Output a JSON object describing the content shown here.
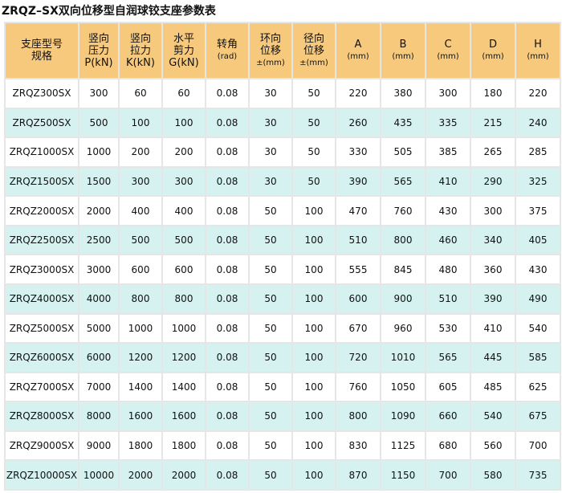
{
  "title": "ZRQZ–SX双向位移型自润球铰支座参数表",
  "headers": [
    {
      "l1": "支座型号",
      "l2": "规格",
      "l3": ""
    },
    {
      "l1": "竖向",
      "l2": "压力",
      "l3": "P(kN)"
    },
    {
      "l1": "竖向",
      "l2": "拉力",
      "l3": "K(kN)"
    },
    {
      "l1": "水平",
      "l2": "剪力",
      "l3": "G(kN)"
    },
    {
      "l1": "转角",
      "l2": "(rad)",
      "l3": ""
    },
    {
      "l1": "环向",
      "l2": "位移",
      "l3": "±(mm)"
    },
    {
      "l1": "径向",
      "l2": "位移",
      "l3": "±(mm)"
    },
    {
      "l1": "A",
      "l2": "(mm)",
      "l3": ""
    },
    {
      "l1": "B",
      "l2": "(mm)",
      "l3": ""
    },
    {
      "l1": "C",
      "l2": "(mm)",
      "l3": ""
    },
    {
      "l1": "D",
      "l2": "(mm)",
      "l3": ""
    },
    {
      "l1": "H",
      "l2": "(mm)",
      "l3": ""
    }
  ],
  "rows": [
    [
      "ZRQZ300SX",
      "300",
      "60",
      "60",
      "0.08",
      "30",
      "50",
      "220",
      "380",
      "300",
      "180",
      "220"
    ],
    [
      "ZRQZ500SX",
      "500",
      "100",
      "100",
      "0.08",
      "30",
      "50",
      "260",
      "435",
      "335",
      "215",
      "240"
    ],
    [
      "ZRQZ1000SX",
      "1000",
      "200",
      "200",
      "0.08",
      "30",
      "50",
      "330",
      "505",
      "385",
      "265",
      "285"
    ],
    [
      "ZRQZ1500SX",
      "1500",
      "300",
      "300",
      "0.08",
      "30",
      "50",
      "390",
      "565",
      "410",
      "290",
      "325"
    ],
    [
      "ZRQZ2000SX",
      "2000",
      "400",
      "400",
      "0.08",
      "50",
      "100",
      "470",
      "760",
      "430",
      "300",
      "375"
    ],
    [
      "ZRQZ2500SX",
      "2500",
      "500",
      "500",
      "0.08",
      "50",
      "100",
      "510",
      "800",
      "460",
      "340",
      "405"
    ],
    [
      "ZRQZ3000SX",
      "3000",
      "600",
      "600",
      "0.08",
      "50",
      "100",
      "555",
      "845",
      "480",
      "360",
      "430"
    ],
    [
      "ZRQZ4000SX",
      "4000",
      "800",
      "800",
      "0.08",
      "50",
      "100",
      "600",
      "900",
      "510",
      "390",
      "490"
    ],
    [
      "ZRQZ5000SX",
      "5000",
      "1000",
      "1000",
      "0.08",
      "50",
      "100",
      "670",
      "960",
      "530",
      "410",
      "540"
    ],
    [
      "ZRQZ6000SX",
      "6000",
      "1200",
      "1200",
      "0.08",
      "50",
      "100",
      "720",
      "1010",
      "565",
      "445",
      "585"
    ],
    [
      "ZRQZ7000SX",
      "7000",
      "1400",
      "1400",
      "0.08",
      "50",
      "100",
      "760",
      "1050",
      "605",
      "485",
      "625"
    ],
    [
      "ZRQZ8000SX",
      "8000",
      "1600",
      "1600",
      "0.08",
      "50",
      "100",
      "800",
      "1090",
      "660",
      "540",
      "675"
    ],
    [
      "ZRQZ9000SX",
      "9000",
      "1800",
      "1800",
      "0.08",
      "50",
      "100",
      "830",
      "1125",
      "680",
      "560",
      "700"
    ],
    [
      "ZRQZ10000SX",
      "10000",
      "2000",
      "2000",
      "0.08",
      "50",
      "100",
      "870",
      "1150",
      "700",
      "580",
      "735"
    ]
  ]
}
